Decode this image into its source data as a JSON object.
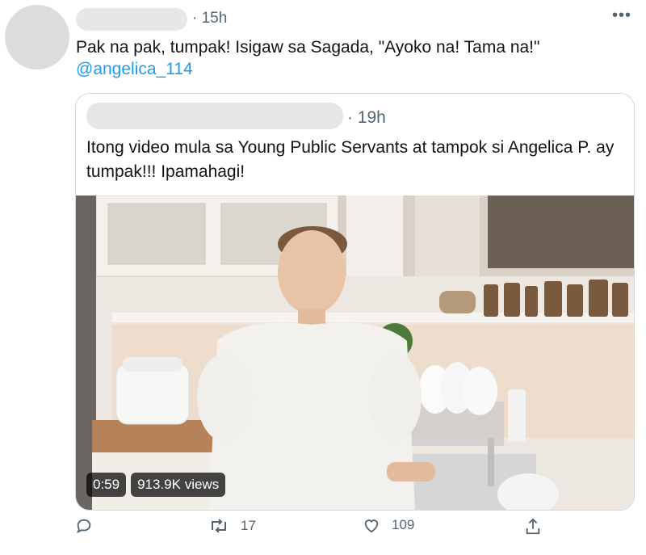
{
  "tweet": {
    "timestamp": "· 15h",
    "text": "Pak na pak, tumpak! Isigaw sa Sagada, \"Ayoko na! Tama na!\"",
    "mention": "@angelica_114",
    "more_icon": "more-icon"
  },
  "quote": {
    "timestamp": "· 19h",
    "text": "Itong video mula sa Young Public Servants at tampok si Angelica P. ay tumpak!!! Ipamahagi!",
    "video": {
      "duration": "0:59",
      "views": "913.9K views"
    }
  },
  "actions": {
    "reply_icon": "reply-icon",
    "retweet_icon": "retweet-icon",
    "retweet_count": "17",
    "like_icon": "heart-icon",
    "like_count": "109",
    "share_icon": "share-icon"
  }
}
